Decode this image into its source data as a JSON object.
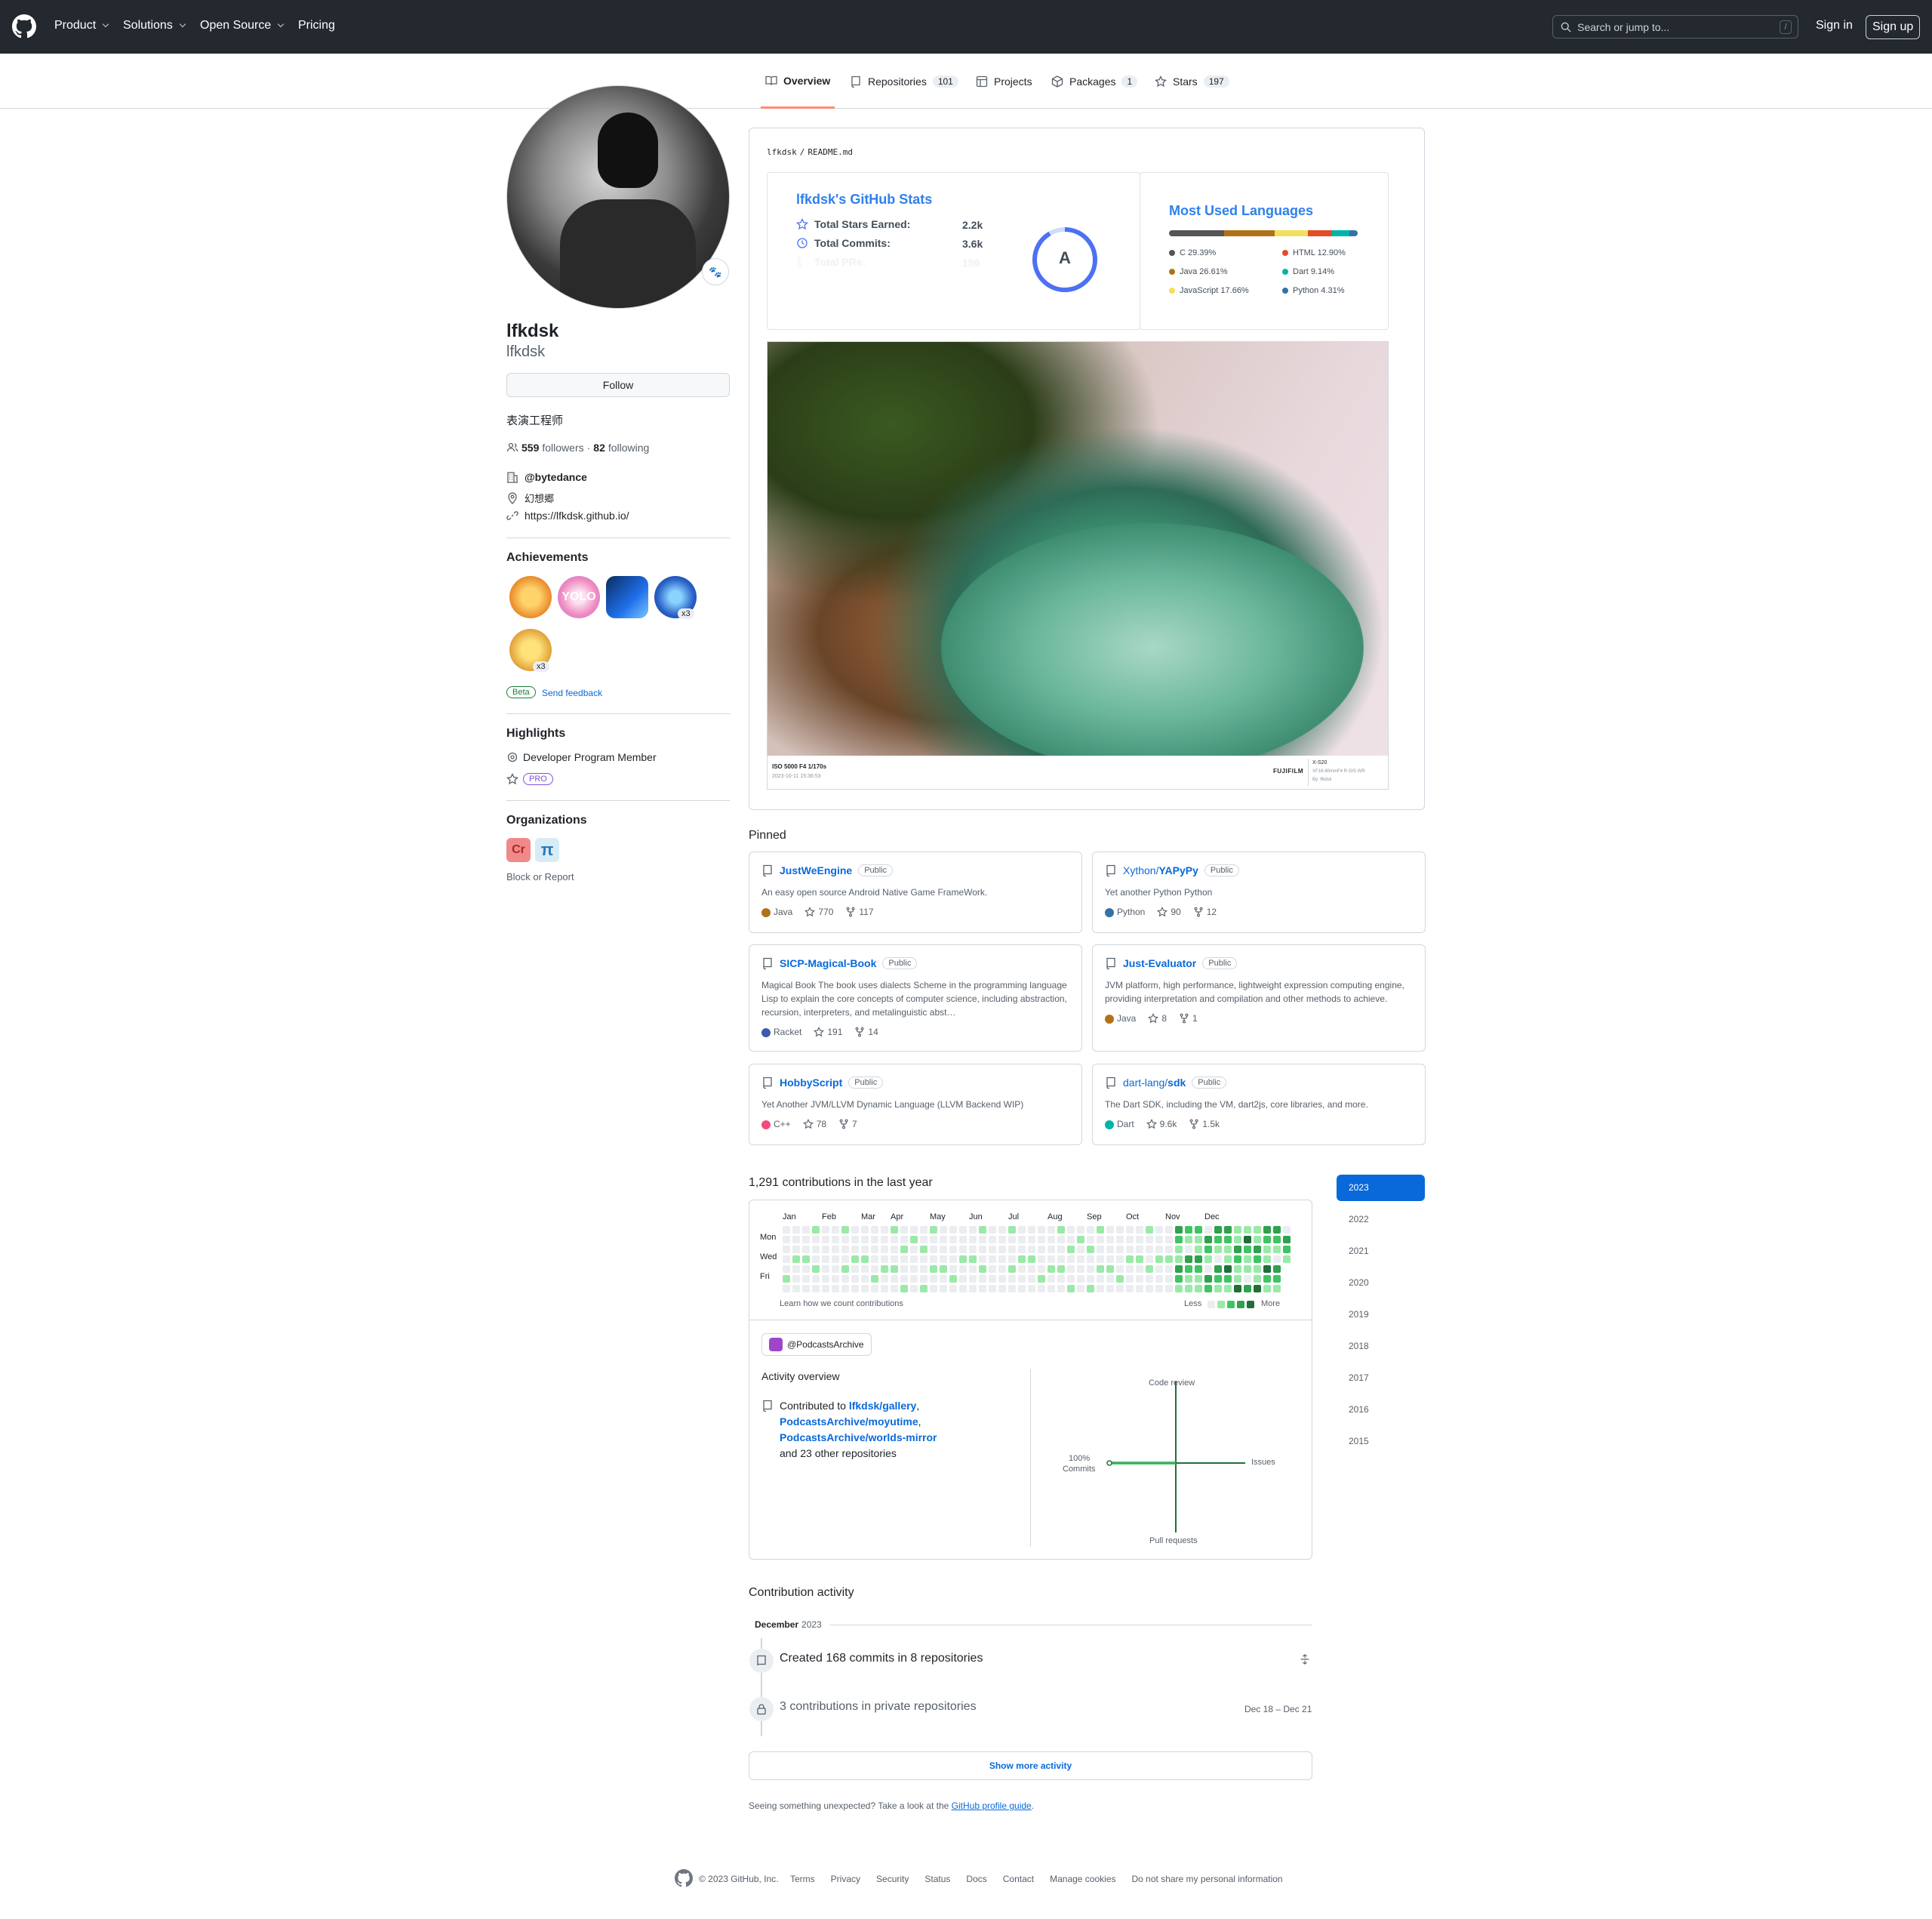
{
  "header": {
    "nav": [
      "Product",
      "Solutions",
      "Open Source",
      "Pricing"
    ],
    "search_placeholder": "Search or jump to...",
    "search_key": "/",
    "sign_in": "Sign in",
    "sign_up": "Sign up"
  },
  "tabs": [
    {
      "label": "Overview"
    },
    {
      "label": "Repositories",
      "count": "101"
    },
    {
      "label": "Projects"
    },
    {
      "label": "Packages",
      "count": "1"
    },
    {
      "label": "Stars",
      "count": "197"
    }
  ],
  "profile": {
    "name": "lfkdsk",
    "login": "lfkdsk",
    "follow": "Follow",
    "bio": "表演工程师",
    "followers": "559",
    "followers_label": "followers",
    "following": "82",
    "following_label": "following",
    "sep": "·",
    "company": "@bytedance",
    "location": "幻想郷",
    "website": "https://lfkdsk.github.io/"
  },
  "achievements": {
    "title": "Achievements",
    "badge_x3a": "x3",
    "badge_x3b": "x3",
    "beta": "Beta",
    "feedback": "Send feedback"
  },
  "highlights": {
    "title": "Highlights",
    "item1": "Developer Program Member",
    "pro": "PRO"
  },
  "organizations": {
    "title": "Organizations",
    "block": "Block or Report"
  },
  "readme": {
    "path_user": "lfkdsk",
    "path_sep": "/",
    "path_file": "README.md"
  },
  "stats": {
    "title": "lfkdsk's GitHub Stats",
    "rows": [
      {
        "label": "Total Stars Earned:",
        "value": "2.2k"
      },
      {
        "label": "Total Commits:",
        "value": "3.6k"
      },
      {
        "label": "Total PRs:",
        "value": "156"
      }
    ],
    "grade": "A"
  },
  "langs": {
    "title": "Most Used Languages",
    "items": [
      {
        "name": "C 29.39%",
        "color": "#555555",
        "pct": 29.39
      },
      {
        "name": "Java 26.61%",
        "color": "#b07219",
        "pct": 26.61
      },
      {
        "name": "JavaScript 17.66%",
        "color": "#f1e05a",
        "pct": 17.66
      },
      {
        "name": "HTML 12.90%",
        "color": "#e34c26",
        "pct": 12.9
      },
      {
        "name": "Dart 9.14%",
        "color": "#00B4AB",
        "pct": 9.14
      },
      {
        "name": "Python 4.31%",
        "color": "#3572A5",
        "pct": 4.31
      }
    ]
  },
  "photo": {
    "exif": "ISO 5000 F4 1/170s",
    "date": "2023-10-11 15:36:53",
    "brand": "FUJIFILM",
    "model": "X-S20",
    "lens": "XF16-80mmF4 R OIS WR",
    "by": "By: lfkdsk"
  },
  "pinned": {
    "title": "Pinned",
    "items": [
      {
        "owner": "",
        "name": "JustWeEngine",
        "badge": "Public",
        "desc": "An easy open source Android Native Game FrameWork.",
        "lang": "Java",
        "color": "#b07219",
        "stars": "770",
        "forks": "117"
      },
      {
        "owner": "Xython/",
        "name": "YAPyPy",
        "badge": "Public",
        "desc": "Yet another Python Python",
        "lang": "Python",
        "color": "#3572A5",
        "stars": "90",
        "forks": "12"
      },
      {
        "owner": "",
        "name": "SICP-Magical-Book",
        "badge": "Public",
        "desc": "Magical Book The book uses dialects Scheme in the programming language Lisp to explain the core concepts of computer science, including abstraction, recursion, interpreters, and metalinguistic abst…",
        "lang": "Racket",
        "color": "#3c5caa",
        "stars": "191",
        "forks": "14"
      },
      {
        "owner": "",
        "name": "Just-Evaluator",
        "badge": "Public",
        "desc": "JVM platform, high performance, lightweight expression computing engine, providing interpretation and compilation and other methods to achieve.",
        "lang": "Java",
        "color": "#b07219",
        "stars": "8",
        "forks": "1"
      },
      {
        "owner": "",
        "name": "HobbyScript",
        "badge": "Public",
        "desc": "Yet Another JVM/LLVM Dynamic Language (LLVM Backend WIP)",
        "lang": "C++",
        "color": "#f34b7d",
        "stars": "78",
        "forks": "7"
      },
      {
        "owner": "dart-lang/",
        "name": "sdk",
        "badge": "Public",
        "desc": "The Dart SDK, including the VM, dart2js, core libraries, and more.",
        "lang": "Dart",
        "color": "#00B4AB",
        "stars": "9.6k",
        "forks": "1.5k"
      }
    ]
  },
  "contrib": {
    "title": "1,291 contributions in the last year",
    "months": [
      "Jan",
      "Feb",
      "Mar",
      "Apr",
      "May",
      "Jun",
      "Jul",
      "Aug",
      "Sep",
      "Oct",
      "Nov",
      "Dec"
    ],
    "days": [
      "Mon",
      "Wed",
      "Fri"
    ],
    "learn": "Learn how we count contributions",
    "less": "Less",
    "more": "More",
    "org": "@PodcastsArchive",
    "overview": "Activity overview",
    "contributed_to": "Contributed to",
    "repo1": "lfkdsk/gallery",
    "repo2": "PodcastsArchive/moyutime",
    "repo3": "PodcastsArchive/worlds-mirror",
    "others": "and 23 other repositories",
    "axis_top": "Code review",
    "axis_right": "Issues",
    "axis_bottom": "Pull requests",
    "axis_left_pct": "100%",
    "axis_left": "Commits"
  },
  "years": [
    "2023",
    "2022",
    "2021",
    "2020",
    "2019",
    "2018",
    "2017",
    "2016",
    "2015"
  ],
  "activity": {
    "title": "Contribution activity",
    "month": "December",
    "year": "2023",
    "created": "Created 168 commits in 8 repositories",
    "private": "3 contributions in private repositories",
    "range": "Dec 18 – Dec 21",
    "show_more": "Show more activity",
    "unexpected": "Seeing something unexpected? Take a look at the",
    "guide": "GitHub profile guide",
    "period": "."
  },
  "footer": {
    "copy": "© 2023 GitHub, Inc.",
    "links": [
      "Terms",
      "Privacy",
      "Security",
      "Status",
      "Docs",
      "Contact",
      "Manage cookies",
      "Do not share my personal information"
    ]
  }
}
